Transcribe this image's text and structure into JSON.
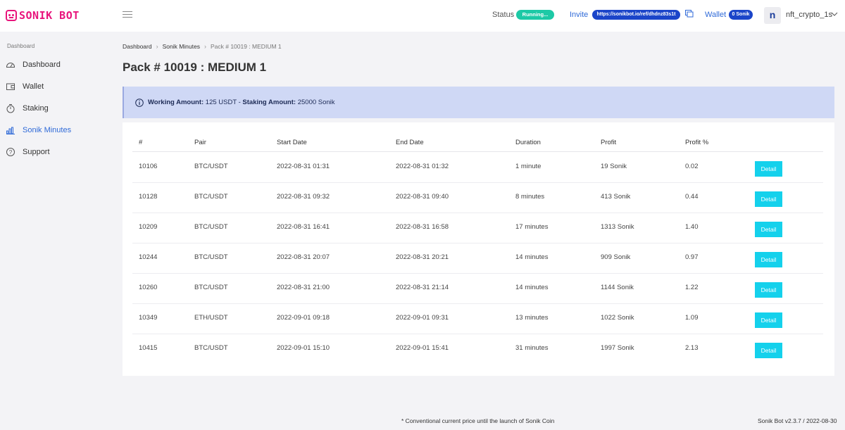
{
  "app": {
    "logo_text": "SONIK BOT"
  },
  "header": {
    "status_label": "Status",
    "status_value": "Running...",
    "invite_label": "Invite",
    "invite_link": "https://sonikbot.io/ref/dhdnz83s1t",
    "wallet_label": "Wallet",
    "wallet_value": "0 Sonik",
    "avatar_letter": "n",
    "username": "nft_crypto_1s",
    "colors": {
      "status": "#1dc9a6",
      "badge": "#1b45c9",
      "accent": "#2f6ad8"
    }
  },
  "sidebar": {
    "heading": "Dashboard",
    "items": [
      {
        "label": "Dashboard",
        "icon": "gauge-icon"
      },
      {
        "label": "Wallet",
        "icon": "wallet-icon"
      },
      {
        "label": "Staking",
        "icon": "timer-icon"
      },
      {
        "label": "Sonik Minutes",
        "icon": "bar-chart-icon",
        "active": true
      },
      {
        "label": "Support",
        "icon": "help-icon"
      }
    ]
  },
  "breadcrumb": [
    "Dashboard",
    "Sonik Minutes",
    "Pack # 10019 : MEDIUM 1"
  ],
  "page_title": "Pack # 10019 : MEDIUM 1",
  "info": {
    "working_label": "Working Amount:",
    "working_value": "125 USDT -",
    "staking_label": "Staking Amount:",
    "staking_value": "25000 Sonik"
  },
  "table": {
    "columns": [
      "#",
      "Pair",
      "Start Date",
      "End Date",
      "Duration",
      "Profit",
      "Profit %"
    ],
    "action_label": "Detail",
    "rows": [
      [
        "10106",
        "BTC/USDT",
        "2022-08-31 01:31",
        "2022-08-31 01:32",
        "1 minute",
        "19 Sonik",
        "0.02"
      ],
      [
        "10128",
        "BTC/USDT",
        "2022-08-31 09:32",
        "2022-08-31 09:40",
        "8 minutes",
        "413 Sonik",
        "0.44"
      ],
      [
        "10209",
        "BTC/USDT",
        "2022-08-31 16:41",
        "2022-08-31 16:58",
        "17 minutes",
        "1313 Sonik",
        "1.40"
      ],
      [
        "10244",
        "BTC/USDT",
        "2022-08-31 20:07",
        "2022-08-31 20:21",
        "14 minutes",
        "909 Sonik",
        "0.97"
      ],
      [
        "10260",
        "BTC/USDT",
        "2022-08-31 21:00",
        "2022-08-31 21:14",
        "14 minutes",
        "1144 Sonik",
        "1.22"
      ],
      [
        "10349",
        "ETH/USDT",
        "2022-09-01 09:18",
        "2022-09-01 09:31",
        "13 minutes",
        "1022 Sonik",
        "1.09"
      ],
      [
        "10415",
        "BTC/USDT",
        "2022-09-01 15:10",
        "2022-09-01 15:41",
        "31 minutes",
        "1997 Sonik",
        "2.13"
      ]
    ]
  },
  "footer": {
    "note": "* Conventional current price until the launch of Sonik Coin",
    "version": "Sonik Bot v2.3.7 / 2022-08-30"
  }
}
